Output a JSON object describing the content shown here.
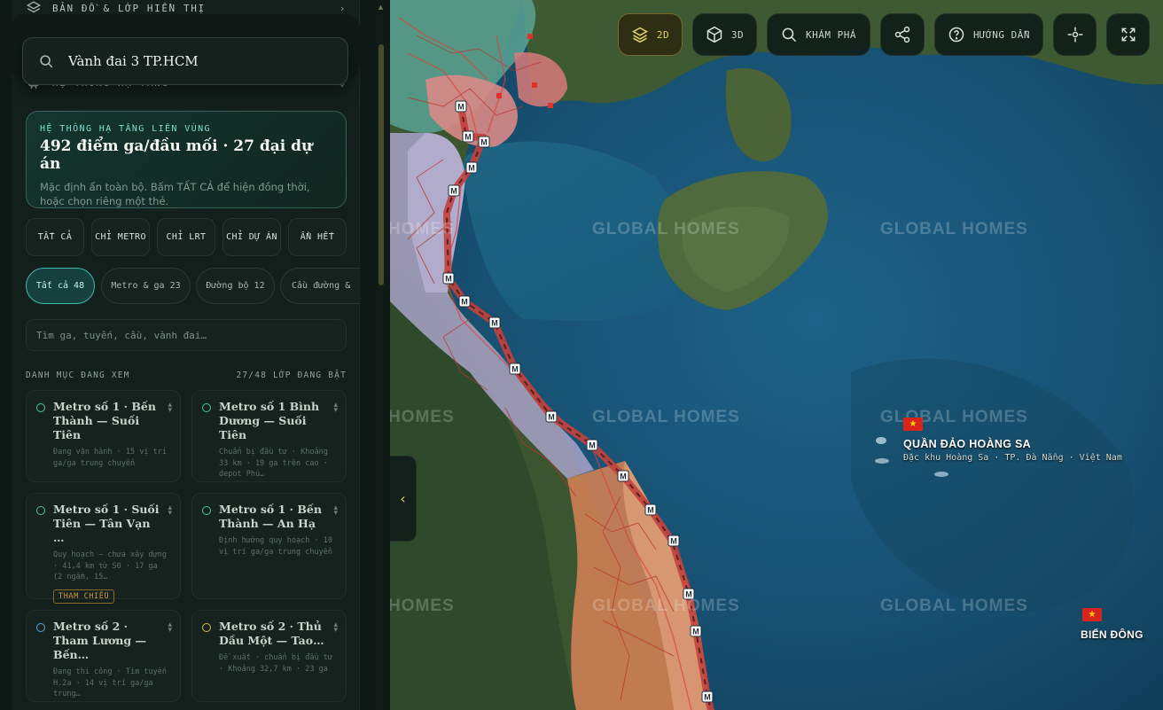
{
  "panel": {
    "section_map_layers": "BẢN ĐỒ & LỚP HIỂN THỊ",
    "section_infrastructure": "HỆ THỐNG HẠ TẦNG",
    "search": {
      "value": "Vành đai 3 TP.HCM"
    },
    "info_card": {
      "eyebrow": "HỆ THỐNG HẠ TẦNG LIÊN VÙNG",
      "headline": "492 điểm ga/đầu mối · 27 đại dự án",
      "description": "Mặc định ẩn toàn bộ. Bấm TẤT CẢ để hiện đồng thời, hoặc chọn riêng một thẻ."
    },
    "filter_buttons": [
      "TẤT CẢ",
      "CHỈ METRO",
      "CHỈ LRT",
      "CHỈ DỰ ÁN",
      "ẨN HẾT"
    ],
    "chips": [
      "Tất cả 48",
      "Metro & ga 23",
      "Đường bộ 12",
      "Cầu đường &"
    ],
    "filter_input_placeholder": "Tìm ga, tuyến, cầu, vành đai…",
    "list_title": "DANH MỤC ĐANG XEM",
    "list_count": "27/48 LỚP ĐANG BẬT",
    "cards": [
      {
        "title": "Metro số 1 · Bến Thành — Suối Tiên",
        "meta": "Đang vận hành · 15 vị trí ga/ga trung chuyển",
        "dot": "green"
      },
      {
        "title": "Metro số 1 Bình Dương — Suối Tiên",
        "meta": "Chuẩn bị đầu tư · Khoảng 33 km · 19 ga trên cao · depot Phú…",
        "dot": "green"
      },
      {
        "title": "Metro số 1 · Suối Tiên — Tân Vạn …",
        "meta": "Quy hoạch — chưa xây dựng · 41,4 km từ S0 · 17 ga (2 ngầm, 15…",
        "dot": "green",
        "badge": "THAM CHIẾU"
      },
      {
        "title": "Metro số 1 · Bến Thành — An Hạ",
        "meta": "Định hướng quy hoạch · 10 vị trí ga/ga trung chuyển",
        "dot": "green"
      },
      {
        "title": "Metro số 2 · Tham Lương — Bến…",
        "meta": "Đang thi công · Tim tuyến H.2a · 14 vị trí ga/ga trung…",
        "dot": "blue"
      },
      {
        "title": "Metro số 2 · Thủ Dầu Một — Tao…",
        "meta": "Đề xuất · chuẩn bị đầu tư · Khoảng 32,7 km · 23 ga",
        "dot": "yellow"
      }
    ]
  },
  "toolbar": {
    "btn_2d": "2D",
    "btn_3d": "3D",
    "btn_explore": "KHÁM PHÁ",
    "btn_guide": "HƯỚNG DẪN",
    "active_color": "#e3cf6a"
  },
  "map": {
    "watermark": "GLOBAL HOMES",
    "watermark_partial": "HOMES",
    "hoang_sa_title": "QUẦN ĐẢO HOÀNG SA",
    "hoang_sa_sub": "Đặc khu Hoàng Sa · TP. Đà Nẵng · Việt Nam",
    "bien_dong": "BIỂN ĐÔNG",
    "station_marker": "M",
    "flag_star": "★",
    "route_color": "#c2413d"
  }
}
